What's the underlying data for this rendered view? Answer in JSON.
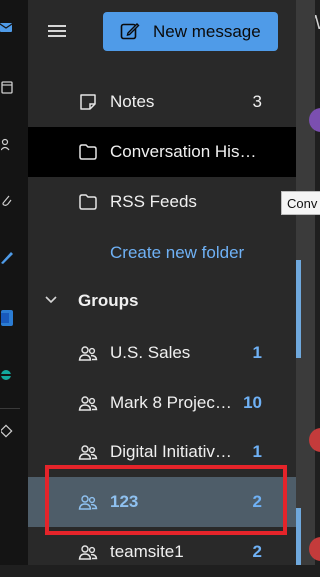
{
  "toolbar": {
    "new_message_label": "New message",
    "tab_fragment": "W"
  },
  "folders": [
    {
      "label": "Notes",
      "count": "3",
      "icon": "note-icon"
    },
    {
      "label": "Conversation His…",
      "count": "",
      "icon": "folder-icon"
    },
    {
      "label": "RSS Feeds",
      "count": "",
      "icon": "folder-icon"
    }
  ],
  "create_folder_label": "Create new folder",
  "groups": {
    "header": "Groups",
    "items": [
      {
        "label": "U.S. Sales",
        "count": "1"
      },
      {
        "label": "Mark 8 Projec…",
        "count": "10"
      },
      {
        "label": "Digital Initiativ…",
        "count": "1"
      },
      {
        "label": "123",
        "count": "2",
        "selected": true
      },
      {
        "label": "teamsite1",
        "count": "2"
      }
    ]
  },
  "tooltip_text": "Conv",
  "colors": {
    "accent": "#4f9be8",
    "count_blue": "#6fb1f5",
    "highlight_box": "#e5242a",
    "selected_bg": "#4e5d69",
    "avatar_purple": "#7b4fb0",
    "avatar_red": "#c43b3b"
  }
}
